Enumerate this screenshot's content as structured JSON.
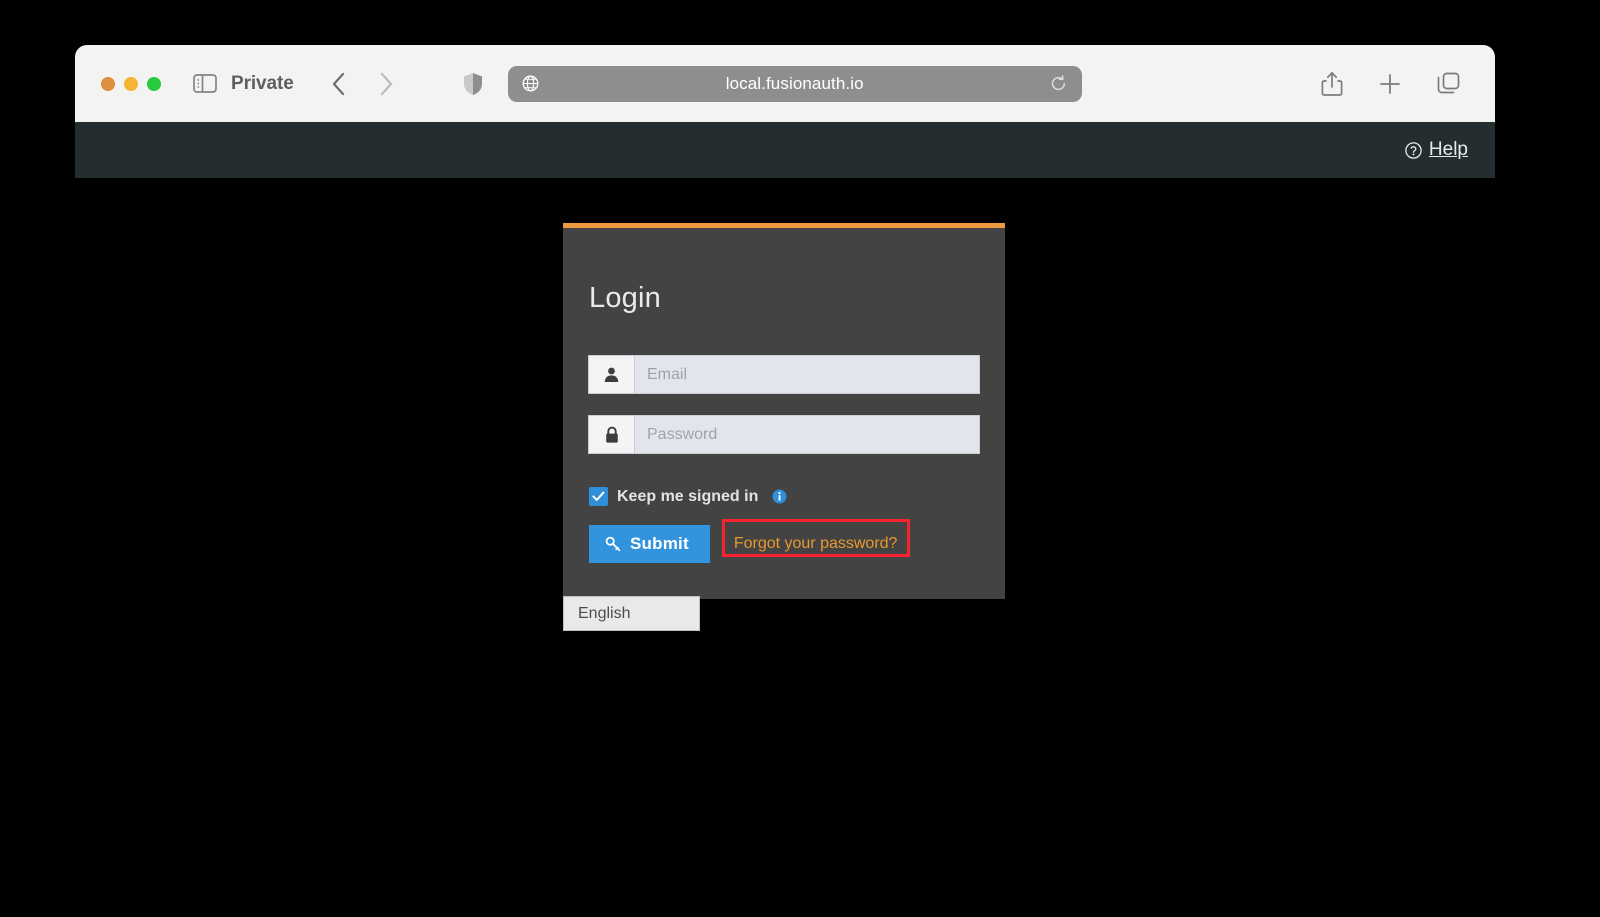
{
  "browser": {
    "profile_label": "Private",
    "url": "local.fusionauth.io",
    "traffic_lights": [
      "close-button",
      "minimize-button",
      "maximize-button"
    ],
    "icons": {
      "sidebar": "sidebar-toggle-icon",
      "back": "back-chevron-icon",
      "forward": "forward-chevron-icon",
      "shield": "privacy-shield-icon",
      "globe": "globe-icon",
      "reload": "reload-icon",
      "share": "share-icon",
      "new_tab": "plus-icon",
      "tab_overview": "tab-overview-icon"
    }
  },
  "page_header": {
    "help_label": "Help",
    "help_icon": "question-circle-icon"
  },
  "login": {
    "title": "Login",
    "accent_color": "#ed9a3e",
    "card_color": "#434343",
    "email": {
      "placeholder": "Email",
      "value": "",
      "icon": "user-icon"
    },
    "password": {
      "placeholder": "Password",
      "value": "",
      "icon": "lock-icon"
    },
    "keep_signed_in": {
      "label": "Keep me signed in",
      "checked": true,
      "checkbox_color": "#2f8fd8",
      "info_icon": "info-circle-icon"
    },
    "submit": {
      "label": "Submit",
      "icon": "key-icon",
      "color": "#3294dd"
    },
    "forgot_password": {
      "label": "Forgot your password?",
      "color": "#e8982f",
      "highlighted": true,
      "highlight_color": "#f8232f"
    }
  },
  "language": {
    "selected": "English"
  }
}
